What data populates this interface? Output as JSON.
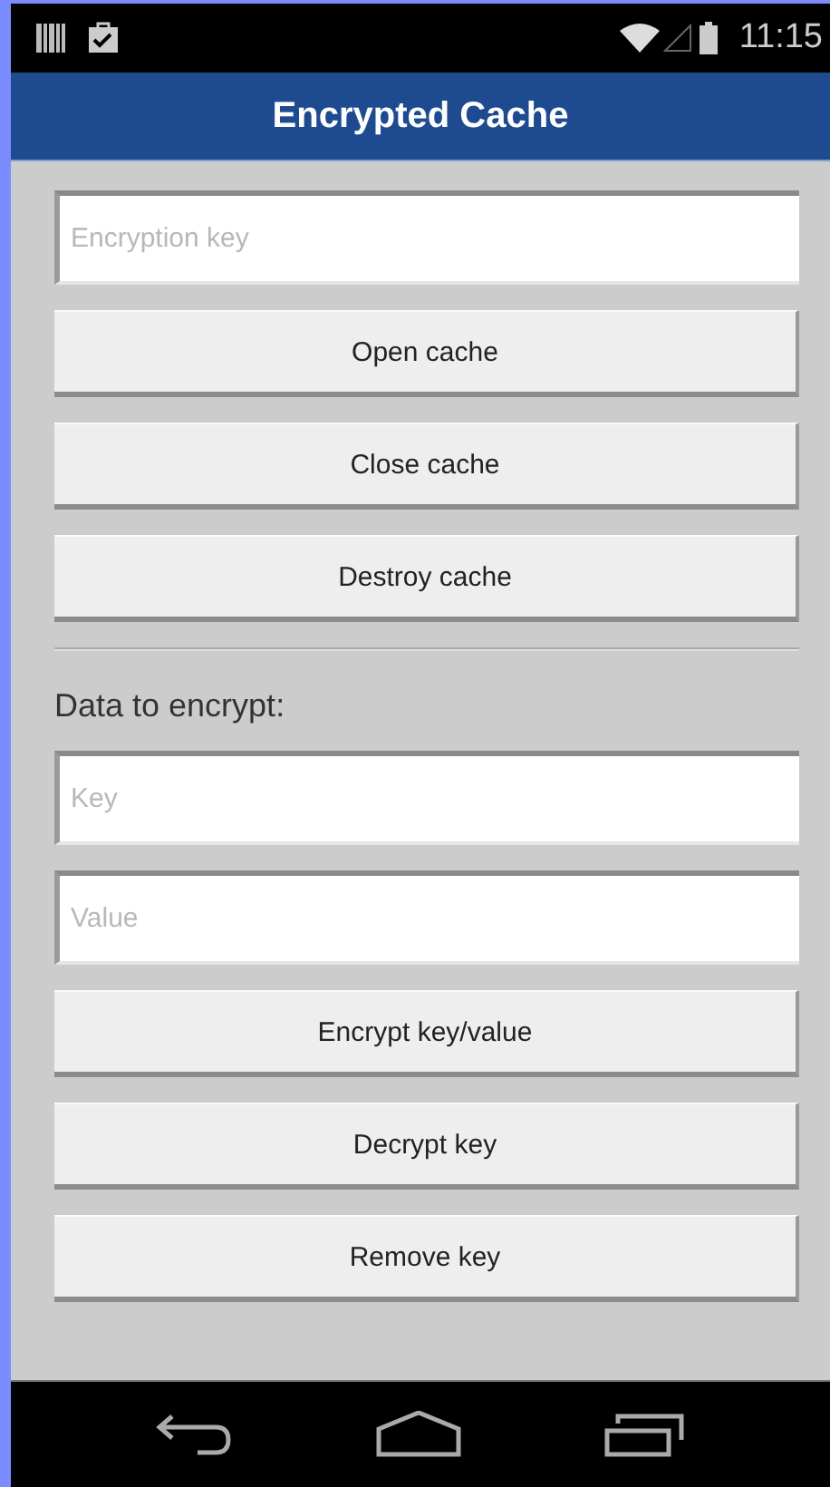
{
  "status_bar": {
    "time": "11:15"
  },
  "app_bar": {
    "title": "Encrypted Cache"
  },
  "cache_section": [
    {
      "kind": "field",
      "placeholder": "Encryption key"
    },
    {
      "kind": "button",
      "label": "Open cache"
    },
    {
      "kind": "button",
      "label": "Close cache"
    },
    {
      "kind": "button",
      "label": "Destroy cache"
    }
  ],
  "data_section": {
    "heading": "Data to encrypt:",
    "items": [
      {
        "kind": "field",
        "placeholder": "Key"
      },
      {
        "kind": "field",
        "placeholder": "Value"
      },
      {
        "kind": "button",
        "label": "Encrypt key/value"
      },
      {
        "kind": "button",
        "label": "Decrypt key"
      },
      {
        "kind": "button",
        "label": "Remove key"
      }
    ]
  }
}
